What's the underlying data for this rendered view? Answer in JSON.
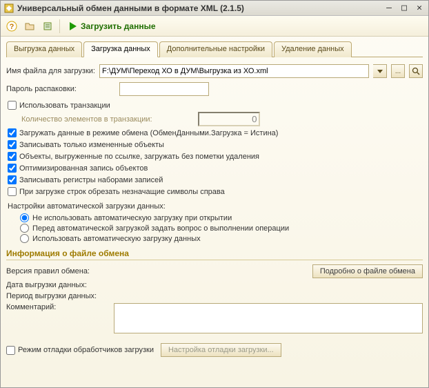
{
  "window": {
    "title": "Универсальный обмен данными в формате XML (2.1.5)"
  },
  "toolbar": {
    "load_label": "Загрузить данные"
  },
  "tabs": {
    "export": "Выгрузка данных",
    "import": "Загрузка данных",
    "extra": "Дополнительные настройки",
    "delete": "Удаление данных"
  },
  "form": {
    "file_label": "Имя файла для загрузки:",
    "file_value": "F:\\ДУМ\\Переход ХО в ДУМ\\Выгрузка из ХО.xml",
    "password_label": "Пароль распаковки:",
    "password_value": "",
    "use_transaction": "Использовать транзакции",
    "txn_count_label": "Количество элементов в транзакции:",
    "txn_count_value": "0",
    "load_exchange_mode": "Загружать данные в режиме обмена (ОбменДанными.Загрузка = Истина)",
    "write_changed_only": "Записывать только измененные объекты",
    "load_by_ref": "Объекты, выгруженные по ссылке, загружать без пометки удаления",
    "optimized_write": "Оптимизированная запись объектов",
    "write_registers": "Записывать регистры наборами записей",
    "trim_strings": "При загрузке строк обрезать незначащие символы справа",
    "auto_load_label": "Настройки автоматической загрузки данных:",
    "radio_no_auto": "Не использовать автоматическую загрузку при открытии",
    "radio_ask": "Перед автоматической загрузкой задать вопрос о выполнении операции",
    "radio_auto": "Использовать автоматическую загрузку данных"
  },
  "info": {
    "header": "Информация о файле обмена",
    "rules_version_label": "Версия правил обмена:",
    "details_btn": "Подробно о файле обмена",
    "export_date_label": "Дата выгрузки данных:",
    "export_period_label": "Период выгрузки данных:",
    "comment_label": "Комментарий:"
  },
  "bottom": {
    "debug_mode": "Режим отладки обработчиков загрузки",
    "debug_settings": "Настройка отладки загрузки..."
  }
}
